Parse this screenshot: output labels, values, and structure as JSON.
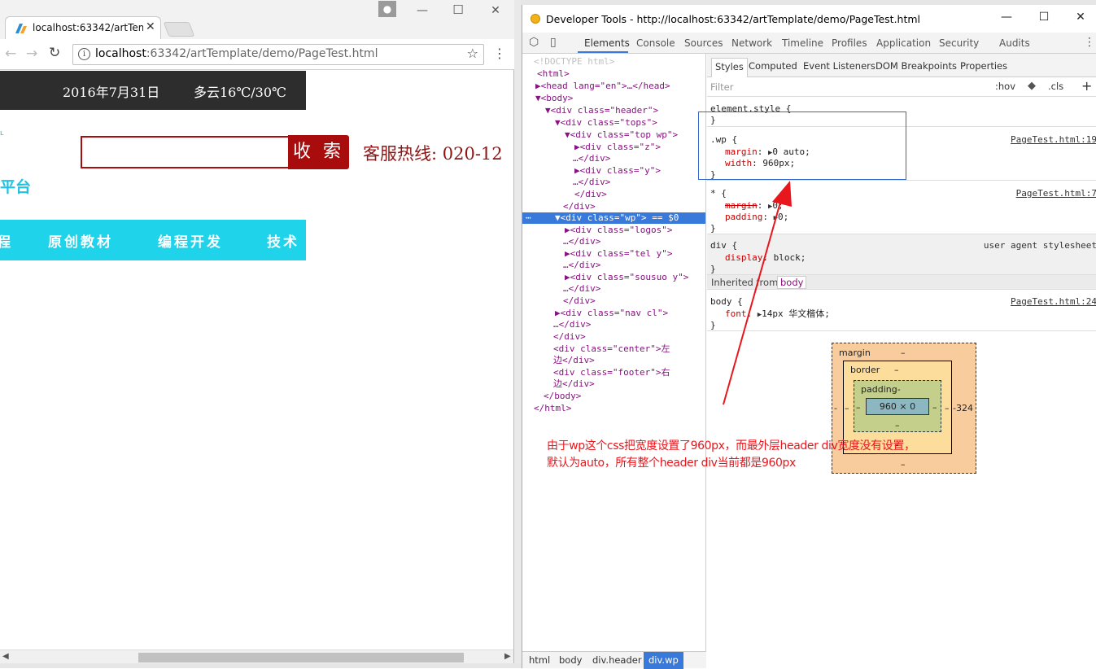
{
  "browser": {
    "tab_title": "localhost:63342/artTem",
    "url_host": "localhost",
    "url_path": ":63342/artTemplate/demo/PageTest.html",
    "page": {
      "date": "2016年7月31日",
      "weather": "多云16℃/30℃",
      "logo_fragment": "ʟ",
      "logo_text": "平台",
      "search_button": "收 索",
      "hotline": "客服热线: 020-12",
      "nav_items": [
        "程",
        "原创教材",
        "编程开发",
        "技术"
      ]
    }
  },
  "devtools": {
    "title": "Developer Tools - http://localhost:63342/artTemplate/demo/PageTest.html",
    "tabs": [
      "Elements",
      "Console",
      "Sources",
      "Network",
      "Timeline",
      "Profiles",
      "Application",
      "Security",
      "Audits"
    ],
    "active_tab": "Elements",
    "dom_lines": [
      {
        "t": "<!DOCTYPE html>"
      },
      {
        "t": "<html>"
      },
      {
        "t": "▶<head lang=\"en\">…</head>"
      },
      {
        "t": "▼<body>"
      },
      {
        "t": "▼<div class=\"header\">"
      },
      {
        "t": "▼<div class=\"tops\">"
      },
      {
        "t": "▼<div class=\"top wp\">"
      },
      {
        "t": "▶<div class=\"z\">"
      },
      {
        "t": "…</div>"
      },
      {
        "t": "▶<div class=\"y\">"
      },
      {
        "t": "…</div>"
      },
      {
        "t": "</div>"
      },
      {
        "t": "</div>"
      },
      {
        "t": "▼<div class=\"wp\"> == $0"
      },
      {
        "t": "▶<div class=\"logos\">"
      },
      {
        "t": "…</div>"
      },
      {
        "t": "▶<div class=\"tel y\">"
      },
      {
        "t": "…</div>"
      },
      {
        "t": "▶<div class=\"sousuo y\">"
      },
      {
        "t": "…</div>"
      },
      {
        "t": "</div>"
      },
      {
        "t": "▶<div class=\"nav cl\">"
      },
      {
        "t": "…</div>"
      },
      {
        "t": "</div>"
      },
      {
        "t": "<div class=\"center\">左"
      },
      {
        "t": "边</div>"
      },
      {
        "t": "<div class=\"footer\">右"
      },
      {
        "t": "边</div>"
      },
      {
        "t": "</body>"
      },
      {
        "t": "</html>"
      }
    ],
    "breadcrumbs": [
      "html",
      "body",
      "div.header",
      "div.wp"
    ],
    "styles": {
      "subtabs": [
        "Styles",
        "Computed",
        "Event Listeners",
        "DOM Breakpoints",
        "Properties"
      ],
      "filter_placeholder": "Filter",
      "hov": ":hov",
      "cls": ".cls",
      "element_style": "element.style {",
      "rules": [
        {
          "selector": ".wp {",
          "source": "PageTest.html:19",
          "props": [
            [
              "margin",
              "0 auto;"
            ],
            [
              "width",
              "960px;"
            ]
          ]
        },
        {
          "selector": "* {",
          "source": "PageTest.html:7",
          "props": [
            [
              "margin",
              "0;"
            ],
            [
              "padding",
              "0;"
            ]
          ]
        },
        {
          "selector": "div {",
          "source": "user agent stylesheet",
          "props": [
            [
              "display",
              "block;"
            ]
          ]
        }
      ],
      "inherited_label": "Inherited from",
      "inherited_from": "body",
      "body_rule": {
        "selector": "body {",
        "source": "PageTest.html:24",
        "prop": "font",
        "value": "14px 华文楷体;"
      }
    },
    "box_model": {
      "margin_label": "margin",
      "border_label": "border",
      "padding_label": "padding-",
      "content": "960 × 0",
      "dash": "–",
      "right_value": "-324",
      "left_value": "-"
    }
  },
  "annotation": {
    "line1": "由于wp这个css把宽度设置了960px，而最外层header div宽度没有设置，",
    "line2": "默认为auto，所有整个header div当前都是960px",
    "color": "#e8161d"
  }
}
